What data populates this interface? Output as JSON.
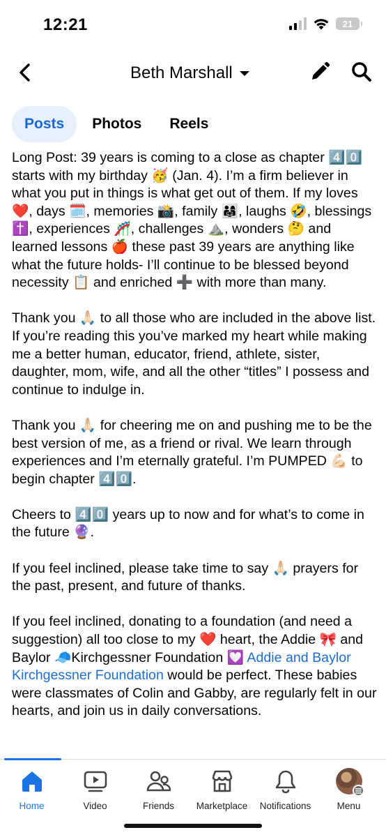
{
  "status_bar": {
    "time": "12:21",
    "battery": "21"
  },
  "header": {
    "title": "Beth Marshall"
  },
  "tabs": [
    {
      "label": "Posts"
    },
    {
      "label": "Photos"
    },
    {
      "label": "Reels"
    }
  ],
  "post": {
    "paragraphs": [
      "Long Post: 39 years is coming to a close as chapter 4️⃣0️⃣ starts with my birthday 🥳 (Jan. 4). I’m a firm believer in what you put in things is what get out of them. If my loves ❤️, days 🗓️, memories 📸, family 👨‍👩‍👧, laughs 🤣, blessings ✝️, experiences 🎢, challenges ⛰️, wonders 🤔 and learned lessons 🍎 these past 39 years are anything like what the future holds- I’ll continue to be blessed beyond necessity 📋 and enriched ➕ with more than many.",
      "Thank you 🙏🏻 to all those who are included in the above list. If you’re reading this you’ve marked my heart while making me a better human, educator, friend, athlete, sister, daughter, mom, wife, and all the other “titles” I possess and continue to indulge in.",
      "Thank you 🙏🏻 for cheering me on and pushing me to be the best version of me, as a friend or rival. We learn through experiences and I’m eternally grateful. I’m PUMPED 💪🏻 to begin chapter 4️⃣0️⃣.",
      "Cheers to 4️⃣0️⃣ years up to now and for what’s to come in the future 🔮.",
      "If you feel inclined, please take time to say 🙏🏻 prayers for the past, present, and future of thanks."
    ],
    "last_paragraph": {
      "before_link": "If you feel inclined, donating to a foundation (and need a suggestion) all too close to my ❤️ heart, the Addie 🎀 and Baylor 🧢Kirchgessner Foundation 💟 ",
      "link_text": "Addie and Baylor Kirchgessner Foundation",
      "after_link": " would be perfect. These babies were classmates of Colin and Gabby, are regularly felt in our hearts, and join us in daily conversations."
    }
  },
  "bottom_nav": [
    {
      "label": "Home",
      "icon": "home-icon"
    },
    {
      "label": "Video",
      "icon": "video-icon"
    },
    {
      "label": "Friends",
      "icon": "friends-icon"
    },
    {
      "label": "Marketplace",
      "icon": "marketplace-icon"
    },
    {
      "label": "Notifications",
      "icon": "bell-icon"
    },
    {
      "label": "Menu",
      "icon": "avatar"
    }
  ],
  "colors": {
    "accent": "#1b74e4",
    "link": "#1b6ed4",
    "active_tab_bg": "#e7f0fd",
    "text": "#050505"
  }
}
